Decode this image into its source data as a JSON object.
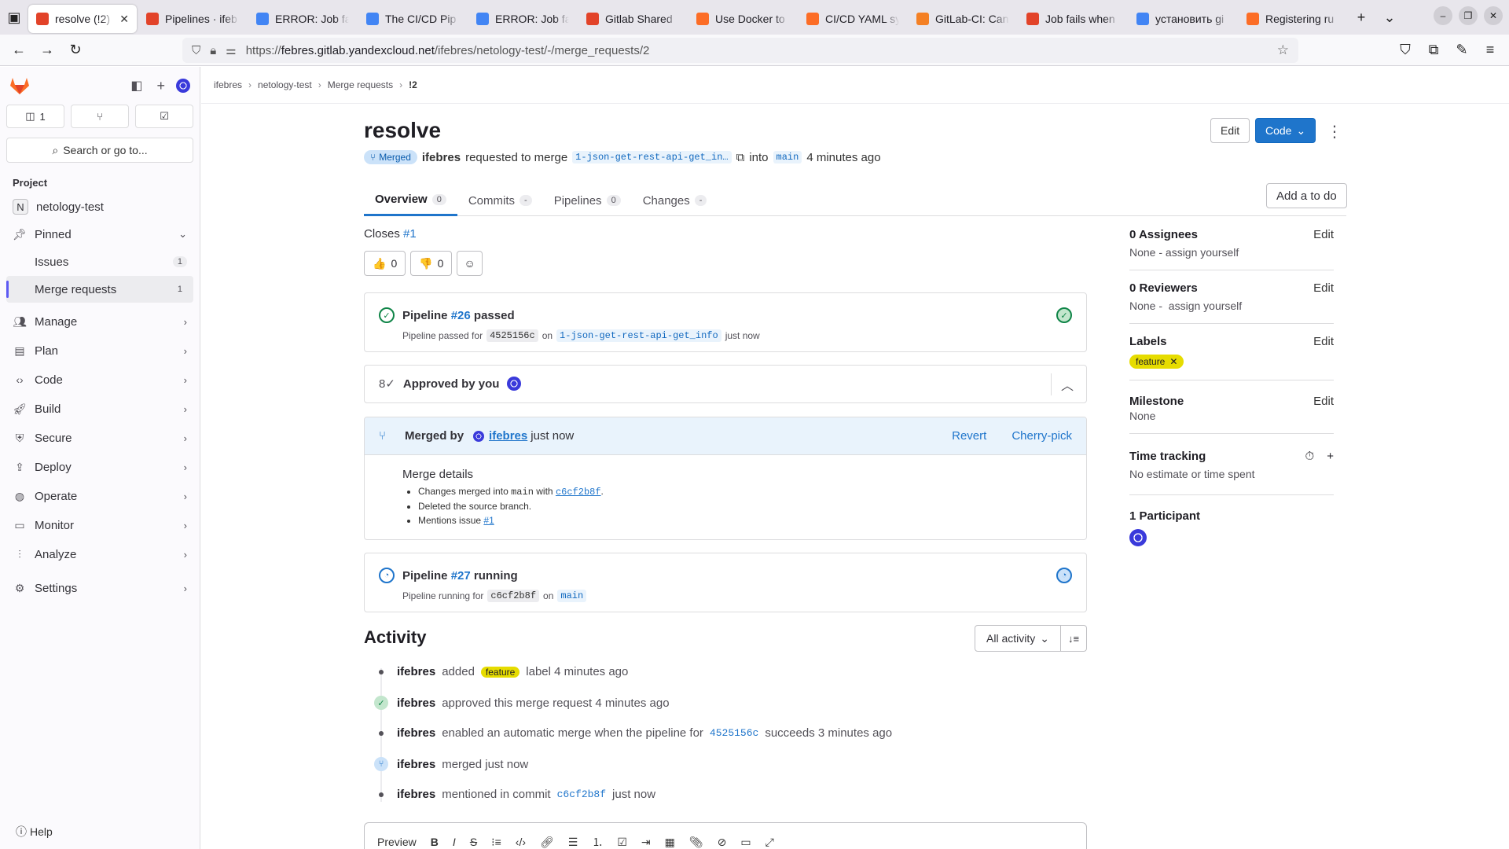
{
  "browser": {
    "tabs": [
      {
        "title": "resolve (!2)",
        "icon": "gitlab-favicon",
        "color": "#e24329",
        "active": true
      },
      {
        "title": "Pipelines · ifeb",
        "icon": "gitlab-favicon",
        "color": "#e24329"
      },
      {
        "title": "ERROR: Job fa",
        "icon": "google-favicon",
        "color": "#4285f4"
      },
      {
        "title": "The CI/CD Pip",
        "icon": "google-favicon",
        "color": "#4285f4"
      },
      {
        "title": "ERROR: Job fa",
        "icon": "google-favicon",
        "color": "#4285f4"
      },
      {
        "title": "Gitlab Shared",
        "icon": "gitlab-favicon",
        "color": "#e24329"
      },
      {
        "title": "Use Docker to",
        "icon": "gitlab-docs-favicon",
        "color": "#fc6d26"
      },
      {
        "title": "CI/CD YAML sy",
        "icon": "gitlab-docs-favicon",
        "color": "#fc6d26"
      },
      {
        "title": "GitLab-CI: Can",
        "icon": "stackoverflow-favicon",
        "color": "#f48024"
      },
      {
        "title": "Job fails when",
        "icon": "gitlab-favicon",
        "color": "#e24329"
      },
      {
        "title": "установить gi",
        "icon": "google-favicon",
        "color": "#4285f4"
      },
      {
        "title": "Registering ru",
        "icon": "gitlab-docs-favicon",
        "color": "#fc6d26"
      }
    ],
    "url_prefix": "https://",
    "url_host": "febres.gitlab.yandexcloud.net",
    "url_path": "/ifebres/netology-test/-/merge_requests/2"
  },
  "sidebar": {
    "counters": {
      "issues": "1"
    },
    "search_label": "Search or go to...",
    "section_label": "Project",
    "project_initial": "N",
    "project_name": "netology-test",
    "pinned_label": "Pinned",
    "pinned_items": [
      {
        "label": "Issues",
        "count": "1"
      },
      {
        "label": "Merge requests",
        "count": "1"
      }
    ],
    "nav": [
      "Manage",
      "Plan",
      "Code",
      "Build",
      "Secure",
      "Deploy",
      "Operate",
      "Monitor",
      "Analyze"
    ],
    "settings_label": "Settings",
    "help_label": "Help"
  },
  "breadcrumb": [
    "ifebres",
    "netology-test",
    "Merge requests",
    "!2"
  ],
  "mr": {
    "title": "resolve",
    "edit_label": "Edit",
    "code_label": "Code",
    "state": "Merged",
    "author": "ifebres",
    "requested_text": "requested to merge",
    "source_branch": "1-json-get-rest-api-get_in…",
    "into_text": "into",
    "target_branch": "main",
    "time_ago": "4 minutes ago"
  },
  "tabs": [
    {
      "label": "Overview",
      "count": "0"
    },
    {
      "label": "Commits",
      "count": "-"
    },
    {
      "label": "Pipelines",
      "count": "0"
    },
    {
      "label": "Changes",
      "count": "-"
    }
  ],
  "add_todo_label": "Add a to do",
  "closes": {
    "text": "Closes",
    "issue": "#1"
  },
  "reactions": {
    "thumbs_up": "0",
    "thumbs_down": "0"
  },
  "pipeline1": {
    "label": "Pipeline",
    "id": "#26",
    "status": "passed",
    "detail_prefix": "Pipeline passed for",
    "sha": "4525156c",
    "on": "on",
    "branch": "1-json-get-rest-api-get_info",
    "time": "just now"
  },
  "approval": {
    "text": "Approved by you"
  },
  "merge": {
    "prefix": "Merged by",
    "user": "ifebres",
    "time": "just now",
    "revert_label": "Revert",
    "cherry_label": "Cherry-pick",
    "details_title": "Merge details",
    "detail1_prefix": "Changes merged into",
    "detail1_branch": "main",
    "detail1_with": "with",
    "detail1_sha": "c6cf2b8f",
    "detail2": "Deleted the source branch.",
    "detail3_prefix": "Mentions issue",
    "detail3_issue": "#1"
  },
  "pipeline2": {
    "label": "Pipeline",
    "id": "#27",
    "status": "running",
    "detail_prefix": "Pipeline running for",
    "sha": "c6cf2b8f",
    "on": "on",
    "branch": "main"
  },
  "right": {
    "assignees_title": "0 Assignees",
    "assignees_value": "None - assign yourself",
    "reviewers_title": "0 Reviewers",
    "reviewers_value": "None -  assign yourself",
    "labels_title": "Labels",
    "label_name": "feature",
    "label_color": "#e6dc00",
    "milestone_title": "Milestone",
    "milestone_value": "None",
    "time_title": "Time tracking",
    "time_value": "No estimate or time spent",
    "participants_title": "1 Participant",
    "edit_label": "Edit"
  },
  "activity": {
    "title": "Activity",
    "filter_label": "All activity",
    "items": [
      {
        "user": "ifebres",
        "pre": "added",
        "label": "feature",
        "post": "label 4 minutes ago"
      },
      {
        "user": "ifebres",
        "pre": "approved this merge request 4 minutes ago"
      },
      {
        "user": "ifebres",
        "pre": "enabled an automatic merge when the pipeline for",
        "sha": "4525156c",
        "post": "succeeds 3 minutes ago"
      },
      {
        "user": "ifebres",
        "pre": "merged just now"
      },
      {
        "user": "ifebres",
        "pre": "mentioned in commit",
        "sha": "c6cf2b8f",
        "post": "just now"
      }
    ]
  },
  "editor": {
    "preview_label": "Preview"
  }
}
